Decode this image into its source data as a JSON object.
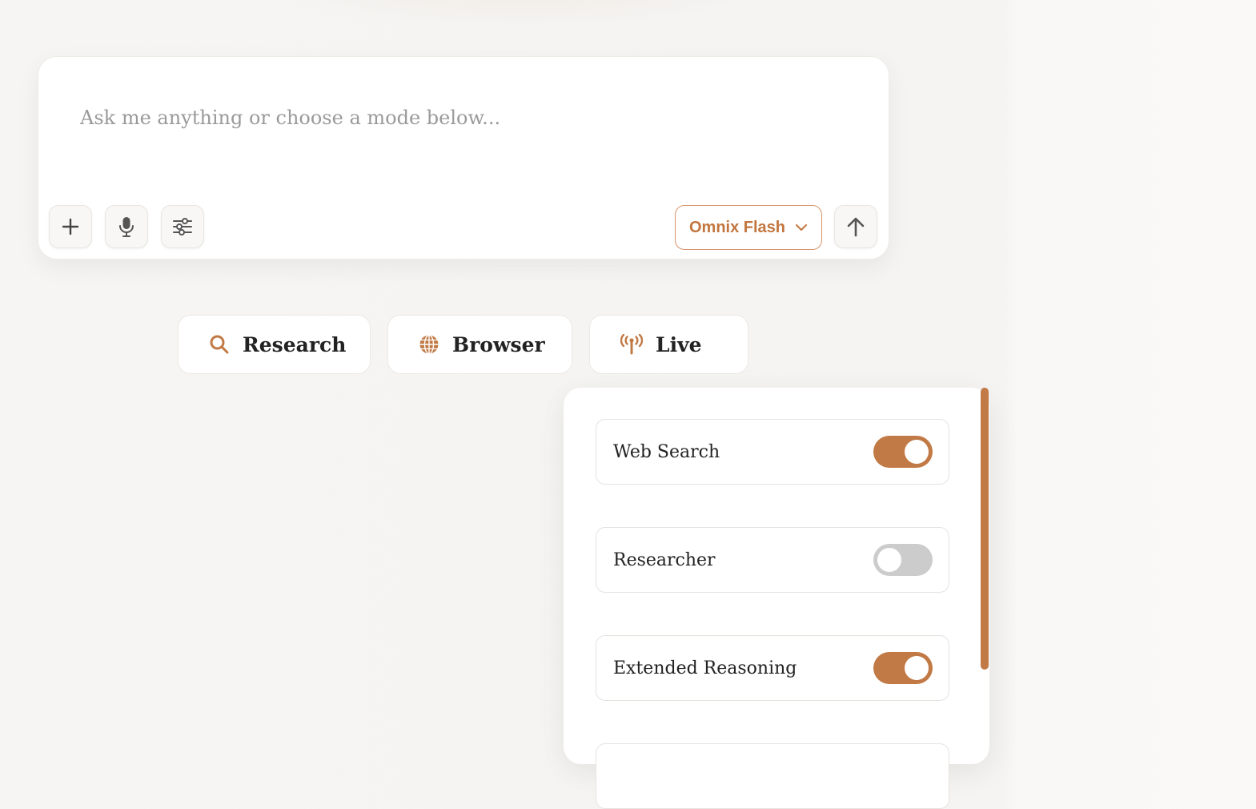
{
  "composer": {
    "placeholder": "Ask me anything or choose a mode below...",
    "add_icon": "plus-icon",
    "mic_icon": "microphone-icon",
    "settings_icon": "sliders-icon",
    "model_selector": {
      "label": "Omnix Flash",
      "icon": "chevron-down-icon"
    },
    "send_icon": "arrow-up-icon"
  },
  "modes": [
    {
      "label": "Research",
      "icon": "search-icon"
    },
    {
      "label": "Browser",
      "icon": "globe-icon"
    },
    {
      "label": "Live",
      "icon": "broadcast-icon"
    }
  ],
  "settings_panel": {
    "options": [
      {
        "label": "Web Search",
        "enabled": true
      },
      {
        "label": "Researcher",
        "enabled": false
      },
      {
        "label": "Extended Reasoning",
        "enabled": true
      }
    ]
  },
  "colors": {
    "accent": "#c17a45",
    "toggle_off": "#cccccc",
    "background": "#f6f5f3"
  }
}
